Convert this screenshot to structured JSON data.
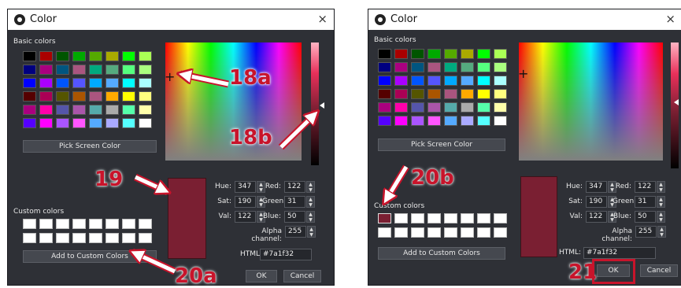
{
  "dialog": {
    "title": "Color",
    "close_glyph": "×",
    "basic_colors_label": "Basic colors",
    "custom_colors_label": "Custom colors",
    "pick_screen_label": "Pick Screen Color",
    "add_custom_label": "Add to Custom Colors",
    "fields": {
      "hue_label": "Hue:",
      "hue": "347",
      "sat_label": "Sat:",
      "sat": "190",
      "val_label": "Val:",
      "val": "122",
      "red_label": "Red:",
      "red": "122",
      "green_label": "Green:",
      "green": "31",
      "blue_label": "Blue:",
      "blue": "50",
      "alpha_label": "Alpha channel:",
      "alpha": "255",
      "html_label": "HTML:",
      "html": "#7a1f32"
    },
    "ok_label": "OK",
    "cancel_label": "Cancel",
    "spin_up": "▲",
    "spin_down": "▼",
    "crosshair": "+"
  },
  "basic_colors": [
    "#000000",
    "#aa0000",
    "#005500",
    "#00aa00",
    "#55aa00",
    "#aaaa00",
    "#00ff00",
    "#aaff55",
    "#000080",
    "#aa0080",
    "#005580",
    "#aa5580",
    "#00aa7f",
    "#55aa7f",
    "#55ff7f",
    "#aaff7f",
    "#0000ff",
    "#aa00ff",
    "#0055ff",
    "#5555ff",
    "#00aaff",
    "#55aaff",
    "#00ffff",
    "#aaffff",
    "#550000",
    "#aa0055",
    "#555500",
    "#aa5500",
    "#aa557f",
    "#ffaa00",
    "#ffff00",
    "#ffff7f",
    "#aa007f",
    "#ff00aa",
    "#5555aa",
    "#aa55aa",
    "#55aaaa",
    "#aaaaaa",
    "#55ffaa",
    "#ffffaa",
    "#5500ff",
    "#ff00ff",
    "#aa55ff",
    "#ff55ff",
    "#55aaff",
    "#aaaaff",
    "#55ffff",
    "#ffffff"
  ],
  "selected_color": "#7a1f32",
  "annotations": {
    "a18a": "18a",
    "a18b": "18b",
    "a19": "19",
    "a20a": "20a",
    "a20b": "20b",
    "a21": "21"
  }
}
